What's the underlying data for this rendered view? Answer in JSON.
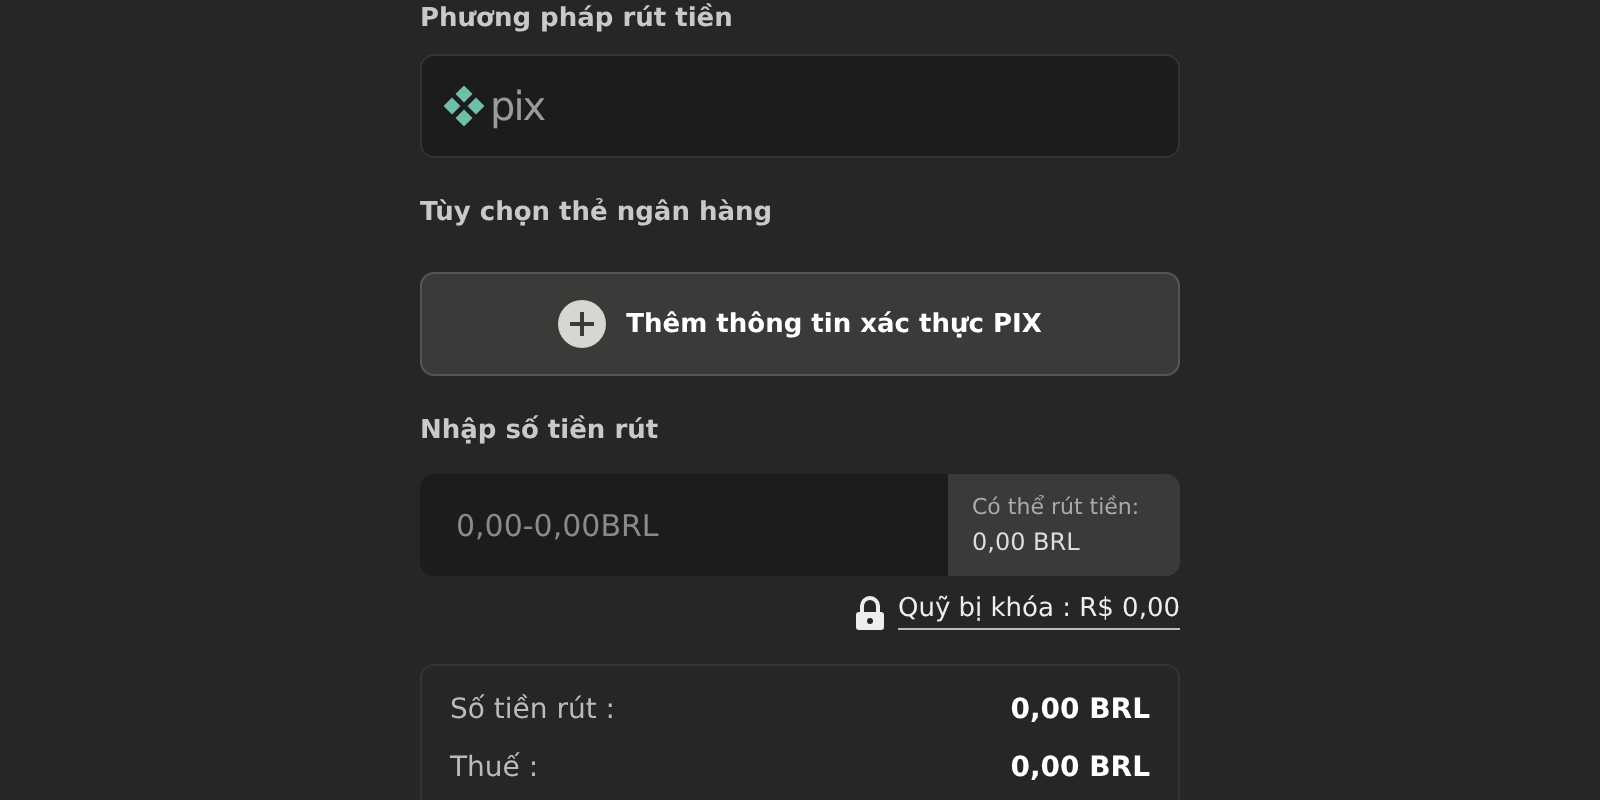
{
  "withdraw_method": {
    "label": "Phương pháp rút tiền",
    "logo_text": "pix"
  },
  "bank_option": {
    "label": "Tùy chọn thẻ ngân hàng",
    "add_button": "Thêm thông tin xác thực PIX"
  },
  "amount": {
    "label": "Nhập số tiền rút",
    "placeholder": "0,00-0,00BRL",
    "available_label": "Có thể rút tiền:",
    "available_value": "0,00 BRL",
    "locked_funds": "Quỹ bị khóa : R$ 0,00"
  },
  "summary": [
    {
      "label": "Số tiền rút :",
      "value": "0,00 BRL"
    },
    {
      "label": "Thuế :",
      "value": "0,00 BRL"
    }
  ]
}
